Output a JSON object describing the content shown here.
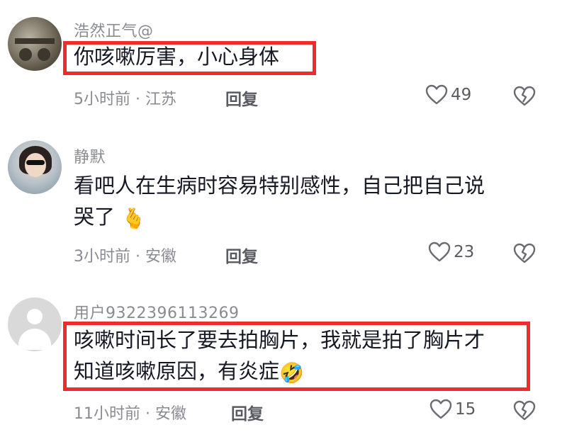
{
  "comments": [
    {
      "username": "浩然正气@",
      "lines": [
        "你咳嗽厉害，小心身体"
      ],
      "time": "5小时前",
      "location": "江苏",
      "reply_label": "回复",
      "likes": "49",
      "highlighted": true
    },
    {
      "username": "静默",
      "lines": [
        "看吧人在生病时容易特别感性，自己把自己说",
        "哭了"
      ],
      "emoji": "🫰",
      "time": "3小时前",
      "location": "安徽",
      "reply_label": "回复",
      "likes": "23",
      "highlighted": false
    },
    {
      "username": "用户9322396113269",
      "lines": [
        "咳嗽时间长了要去拍胸片，我就是拍了胸片才",
        "知道咳嗽原因，有炎症"
      ],
      "emoji": "🤣",
      "time": "11小时前",
      "location": "安徽",
      "reply_label": "回复",
      "likes": "15",
      "highlighted": true
    }
  ],
  "meta_separator": " · ",
  "icons": {
    "like": "heart-outline-icon",
    "dislike": "broken-heart-icon"
  },
  "colors": {
    "highlight_border": "#ef2b2b",
    "meta_text": "#8a8b91",
    "body_text": "#161823"
  }
}
